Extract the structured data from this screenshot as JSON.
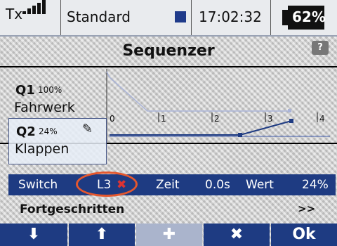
{
  "status": {
    "tx_label": "Tx",
    "model_name": "Standard",
    "time": "17:02:32",
    "battery": "62%"
  },
  "title": "Sequenzer",
  "help_label": "?",
  "channels": [
    {
      "code": "Q1",
      "pct": "100%",
      "name": "Fahrwerk"
    },
    {
      "code": "Q2",
      "pct": "24%",
      "name": "Klappen"
    }
  ],
  "graph": {
    "ticks": [
      "0",
      "1",
      "2",
      "3",
      "4"
    ]
  },
  "params": {
    "switch_label": "Switch",
    "switch_value": "L3",
    "switch_clear": "✖",
    "time_label": "Zeit",
    "time_value": "0.0s",
    "value_label": "Wert",
    "value_value": "24%"
  },
  "advanced": {
    "label": "Fortgeschritten",
    "arrow": ">>"
  },
  "toolbar": {
    "down": "⬇",
    "up": "⬆",
    "add": "✚",
    "delete": "✖",
    "ok": "Ok"
  },
  "colors": {
    "accent": "#1e3b82",
    "highlight": "#e4572e"
  }
}
